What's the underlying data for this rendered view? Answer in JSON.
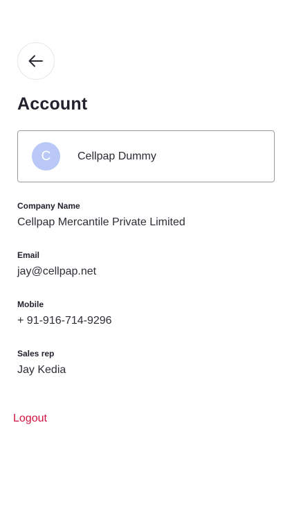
{
  "header": {
    "back_icon": "arrow-left-icon",
    "title": "Account"
  },
  "profile": {
    "avatar_initial": "C",
    "avatar_color": "#b9c8f6",
    "name": "Cellpap Dummy"
  },
  "fields": [
    {
      "label": "Company Name",
      "value": "Cellpap Mercantile Private Limited"
    },
    {
      "label": "Email",
      "value": "jay@cellpap.net"
    },
    {
      "label": "Mobile",
      "value": "+ 91-916-714-9296"
    },
    {
      "label": "Sales rep",
      "value": "Jay Kedia"
    }
  ],
  "logout": {
    "label": "Logout",
    "color": "#d0113e"
  }
}
